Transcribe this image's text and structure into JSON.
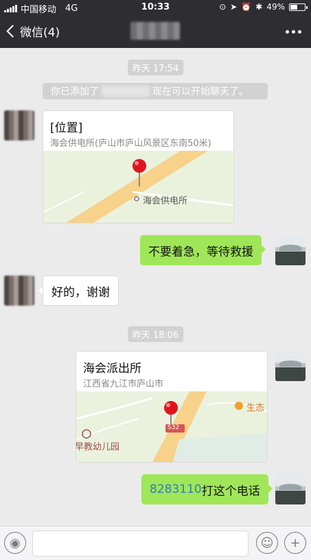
{
  "status_bar": {
    "carrier": "中国移动",
    "network": "4G",
    "time": "10:33",
    "battery": "49%",
    "battery_level": 0.49
  },
  "nav": {
    "back_label": "微信(4)",
    "icons": [
      "back-chevron-icon",
      "more-dots-icon"
    ]
  },
  "chat": {
    "timestamp_1": "昨天 17:54",
    "system_message_prefix": "你已添加了",
    "system_message_suffix": "现在可以开始聊天了。",
    "location_1": {
      "title": "[位置]",
      "address": "海会供电所(庐山市庐山风景区东南50米)",
      "map_label": "海会供电所"
    },
    "msg_self_1": "不要着急，等待救援",
    "msg_friend_1": "好的，谢谢",
    "timestamp_2": "昨天 18:06",
    "location_2": {
      "title": "海会派出所",
      "address": "江西省九江市庐山市",
      "map_labels": {
        "poi_right": "生态",
        "road_badge": "S32",
        "kindergarten": "早教幼儿园"
      }
    },
    "msg_self_2": {
      "phone": "8283110",
      "text": "打这个电话"
    }
  },
  "input_bar": {
    "icons": [
      "voice-icon",
      "emoji-icon",
      "plus-icon"
    ]
  },
  "colors": {
    "nav_bg": "#2e2e32",
    "chat_bg": "#ebebeb",
    "self_bubble": "#9fe658",
    "map_road": "#f6d28a"
  }
}
